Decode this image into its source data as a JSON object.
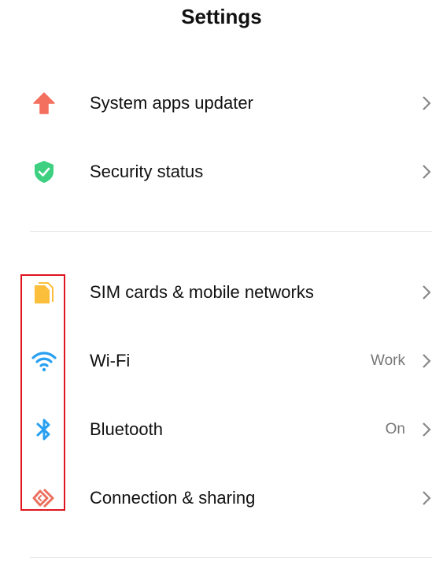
{
  "header": {
    "title": "Settings"
  },
  "sections": [
    {
      "items": [
        {
          "label": "System apps updater",
          "icon": "arrow-up-icon",
          "color": "#f36f5e",
          "value": ""
        },
        {
          "label": "Security status",
          "icon": "shield-check-icon",
          "color": "#3dd080",
          "value": ""
        }
      ]
    },
    {
      "items": [
        {
          "label": "SIM cards & mobile networks",
          "icon": "sim-card-icon",
          "color": "#fbbf3b",
          "value": ""
        },
        {
          "label": "Wi-Fi",
          "icon": "wifi-icon",
          "color": "#2aa0f0",
          "value": "Work"
        },
        {
          "label": "Bluetooth",
          "icon": "bluetooth-icon",
          "color": "#2aa0f0",
          "value": "On"
        },
        {
          "label": "Connection & sharing",
          "icon": "connection-sharing-icon",
          "color": "#ec6f5d",
          "value": ""
        }
      ]
    }
  ],
  "highlight_color": "#e0141e"
}
